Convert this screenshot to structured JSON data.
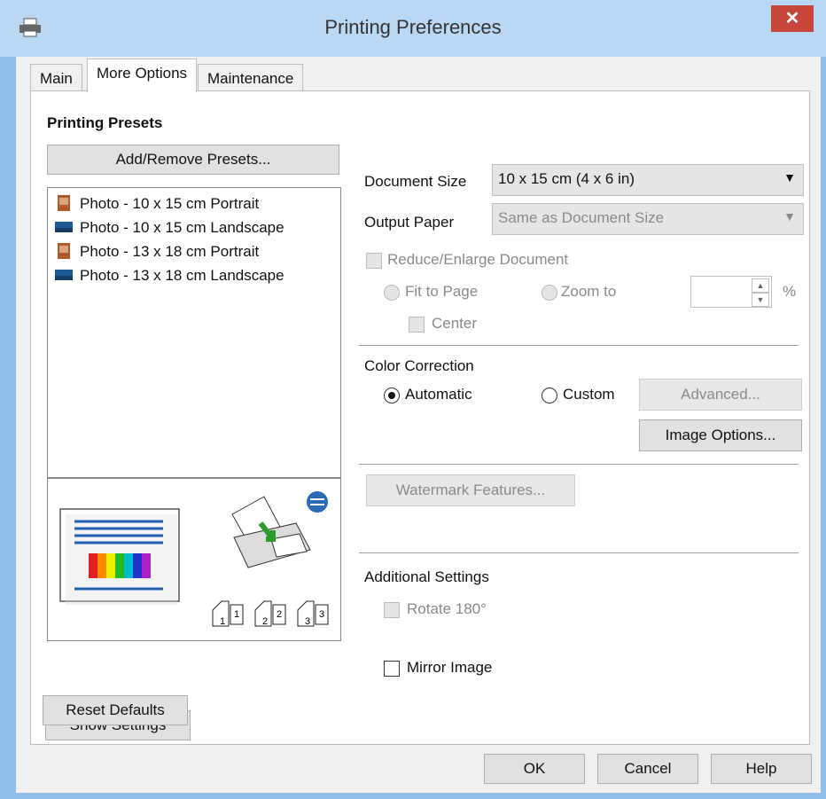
{
  "window": {
    "title": "Printing Preferences",
    "close_glyph": "✕"
  },
  "tabs": [
    {
      "label": "Main",
      "active": false
    },
    {
      "label": "More Options",
      "active": true
    },
    {
      "label": "Maintenance",
      "active": false
    }
  ],
  "presets": {
    "heading": "Printing Presets",
    "add_remove_label": "Add/Remove Presets...",
    "items": [
      {
        "label": "Photo - 10 x 15 cm Portrait",
        "icon": "photo-portrait-icon"
      },
      {
        "label": "Photo - 10 x 15 cm Landscape",
        "icon": "photo-landscape-icon"
      },
      {
        "label": "Photo - 13 x 18 cm Portrait",
        "icon": "photo-portrait-icon"
      },
      {
        "label": "Photo - 13 x 18 cm Landscape",
        "icon": "photo-landscape-icon"
      }
    ]
  },
  "left_buttons": {
    "show_settings": "Show Settings",
    "reset_defaults": "Reset Defaults"
  },
  "paper": {
    "document_size_label": "Document Size",
    "document_size_value": "10 x 15 cm (4 x 6 in)",
    "output_paper_label": "Output Paper",
    "output_paper_value": "Same as Document Size",
    "reduce_enlarge_label": "Reduce/Enlarge Document",
    "fit_to_page_label": "Fit to Page",
    "zoom_to_label": "Zoom to",
    "percent_label": "%",
    "center_label": "Center"
  },
  "color": {
    "heading": "Color Correction",
    "automatic_label": "Automatic",
    "custom_label": "Custom",
    "selected": "Automatic",
    "advanced_label": "Advanced...",
    "image_options_label": "Image Options..."
  },
  "watermark": {
    "label": "Watermark Features..."
  },
  "additional": {
    "heading": "Additional Settings",
    "rotate_label": "Rotate 180°",
    "mirror_label": "Mirror Image"
  },
  "footer": {
    "ok": "OK",
    "cancel": "Cancel",
    "help": "Help"
  },
  "colors": {
    "titlebar": "#b9d8f3",
    "frame": "#8fbfe8",
    "close": "#c9463d"
  }
}
